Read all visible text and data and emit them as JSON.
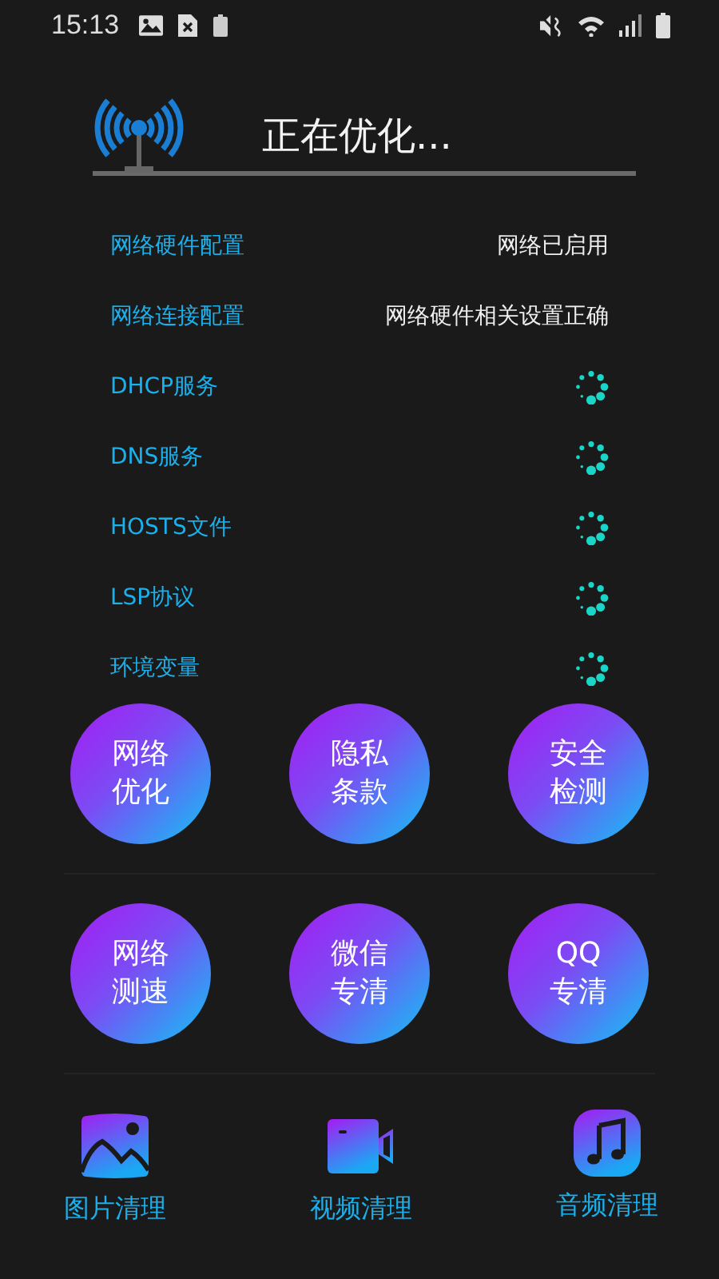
{
  "status_bar": {
    "time": "15:13"
  },
  "header": {
    "title": "正在优化..."
  },
  "checks": [
    {
      "label": "网络硬件配置",
      "kind": "text",
      "value": "网络已启用"
    },
    {
      "label": "网络连接配置",
      "kind": "text",
      "value": "网络硬件相关设置正确"
    },
    {
      "label": "DHCP服务",
      "kind": "spinner"
    },
    {
      "label": "DNS服务",
      "kind": "spinner"
    },
    {
      "label": "HOSTS文件",
      "kind": "spinner"
    },
    {
      "label": "LSP协议",
      "kind": "spinner"
    },
    {
      "label": "环境变量",
      "kind": "spinner"
    }
  ],
  "tool_rows": [
    [
      "网络优化",
      "隐私条款",
      "安全检测"
    ],
    [
      "网络测速",
      "微信专清",
      "QQ专清"
    ]
  ],
  "bottom_nav": [
    {
      "label": "图片清理",
      "kind": "image"
    },
    {
      "label": "视频清理",
      "kind": "video"
    },
    {
      "label": "音频清理",
      "kind": "audio"
    }
  ]
}
